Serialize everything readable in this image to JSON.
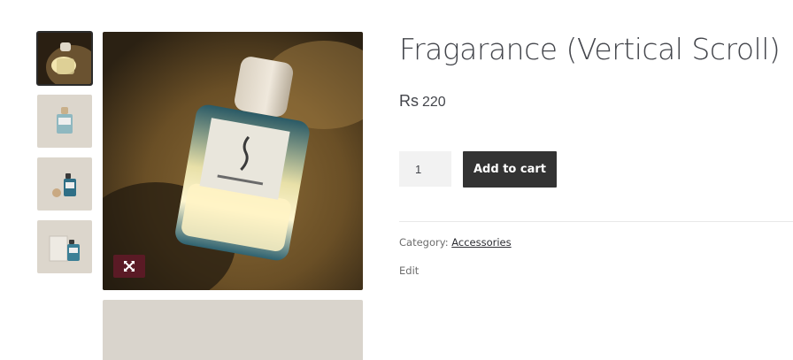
{
  "product": {
    "title": "Fragarance (Vertical Scroll)",
    "currency_symbol": "Rs",
    "price": "220",
    "quantity": "1",
    "add_to_cart_label": "Add to cart",
    "category_label": "Category:",
    "category_value": "Accessories",
    "edit_label": "Edit"
  },
  "gallery": {
    "thumbnail_count": 4,
    "active_index": 0,
    "zoom_icon": "expand-icon"
  },
  "colors": {
    "zoom_button_bg": "#5a1a25",
    "add_to_cart_bg": "#333333",
    "qty_bg": "#f2f2f2"
  }
}
